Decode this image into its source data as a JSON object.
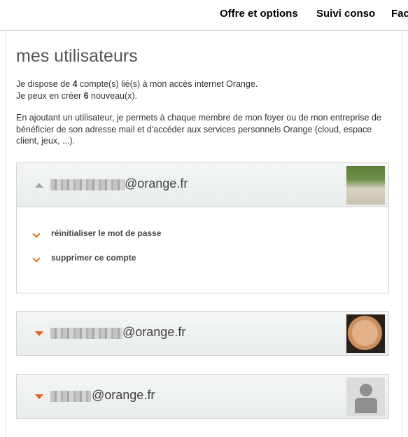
{
  "nav": {
    "items": [
      "Offre et options",
      "Suivi conso",
      "Fac"
    ]
  },
  "page": {
    "title": "mes utilisateurs",
    "intro_line1_a": "Je dispose de ",
    "intro_line1_count": "4",
    "intro_line1_b": " compte(s) lié(s) à mon accès internet Orange.",
    "intro_line2_a": "Je peux en créer ",
    "intro_line2_count": "6",
    "intro_line2_b": " nouveau(x).",
    "intro_paragraph2": "En ajoutant un utilisateur, je permets à chaque membre de mon foyer ou de mon entreprise de bénéficier de son adresse mail et d'accéder aux services personnels Orange (cloud, espace client, jeux, ...)."
  },
  "accounts": [
    {
      "email_domain": "@orange.fr",
      "expanded": true,
      "avatar": "photo-couple",
      "actions": [
        "réinitialiser le mot de passe",
        "supprimer ce compte"
      ]
    },
    {
      "email_domain": "@orange.fr",
      "expanded": false,
      "avatar": "photo-woman"
    },
    {
      "email_domain": "@orange.fr",
      "expanded": false,
      "avatar": "default-user-icon"
    }
  ],
  "colors": {
    "accent": "#e5661b",
    "caret_collapsed": "#a7a7a7",
    "header_bg": "#eef0f0"
  }
}
